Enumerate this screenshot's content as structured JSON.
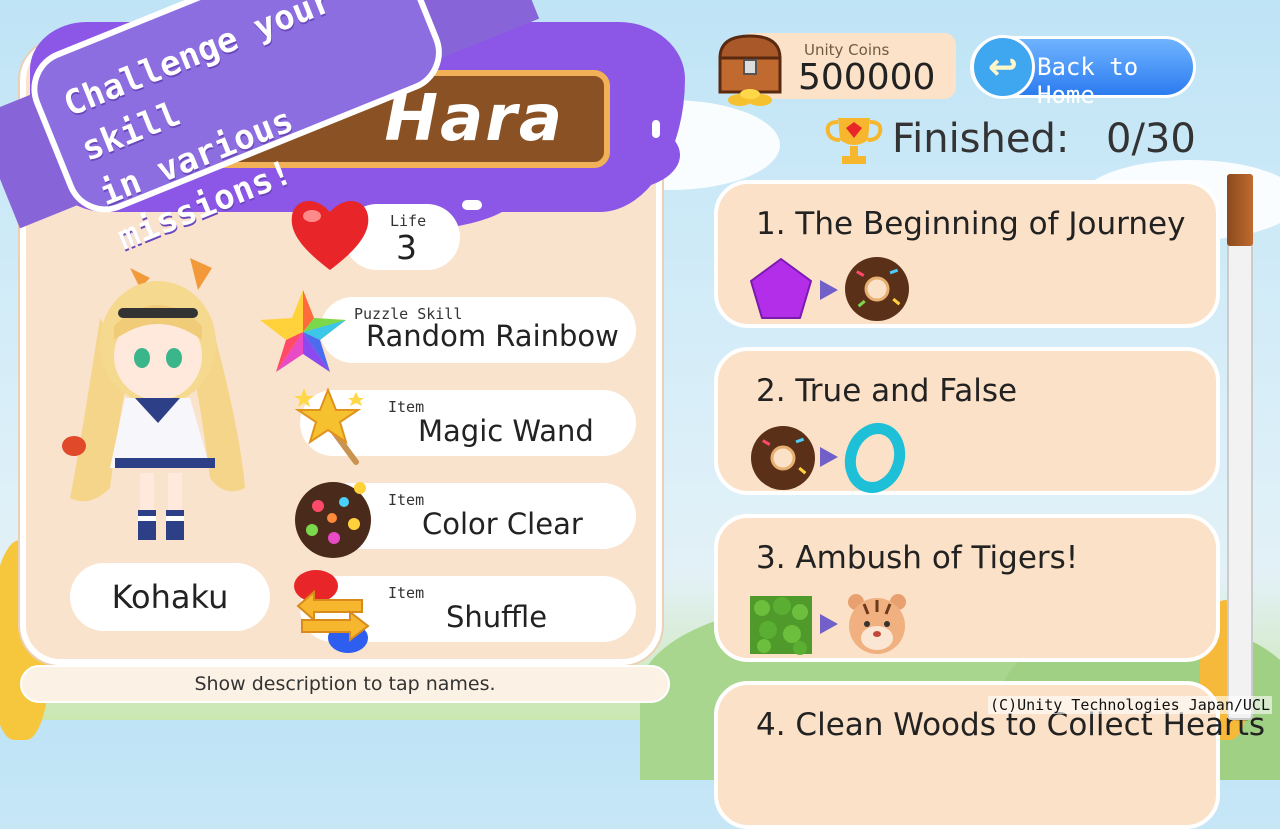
{
  "character": {
    "name_plate": "Hara",
    "name": "Kohaku"
  },
  "banner": {
    "line1": "Challenge your skill",
    "line2": "in various missions!"
  },
  "stats": {
    "life_caption": "Life",
    "life_value": "3",
    "skill_caption": "Puzzle Skill",
    "skill_value": "Random Rainbow",
    "item1_caption": "Item",
    "item1_value": "Magic Wand",
    "item2_caption": "Item",
    "item2_value": "Color Clear",
    "item3_caption": "Item",
    "item3_value": "Shuffle"
  },
  "hint": "Show description to tap names.",
  "coins": {
    "label": "Unity Coins",
    "value": "500000"
  },
  "back_button": "Back to Home",
  "finished": {
    "label": "Finished:",
    "count": "0/30"
  },
  "missions": [
    {
      "title": "1. The Beginning of Journey",
      "from_icon": "purple-pentagon-icon",
      "to_icon": "chocolate-donut-icon"
    },
    {
      "title": "2. True and False",
      "from_icon": "chocolate-donut-icon",
      "to_icon": "blue-ring-icon"
    },
    {
      "title": "3. Ambush of Tigers!",
      "from_icon": "grass-block-icon",
      "to_icon": "tiger-icon"
    },
    {
      "title": "4. Clean Woods to Collect Hearts"
    }
  ],
  "copyright": "(C)Unity Technologies Japan/UCL",
  "colors": {
    "accent_purple": "#8c56e6",
    "panel": "#f9e3cd",
    "button_blue": "#2c7cf0"
  }
}
